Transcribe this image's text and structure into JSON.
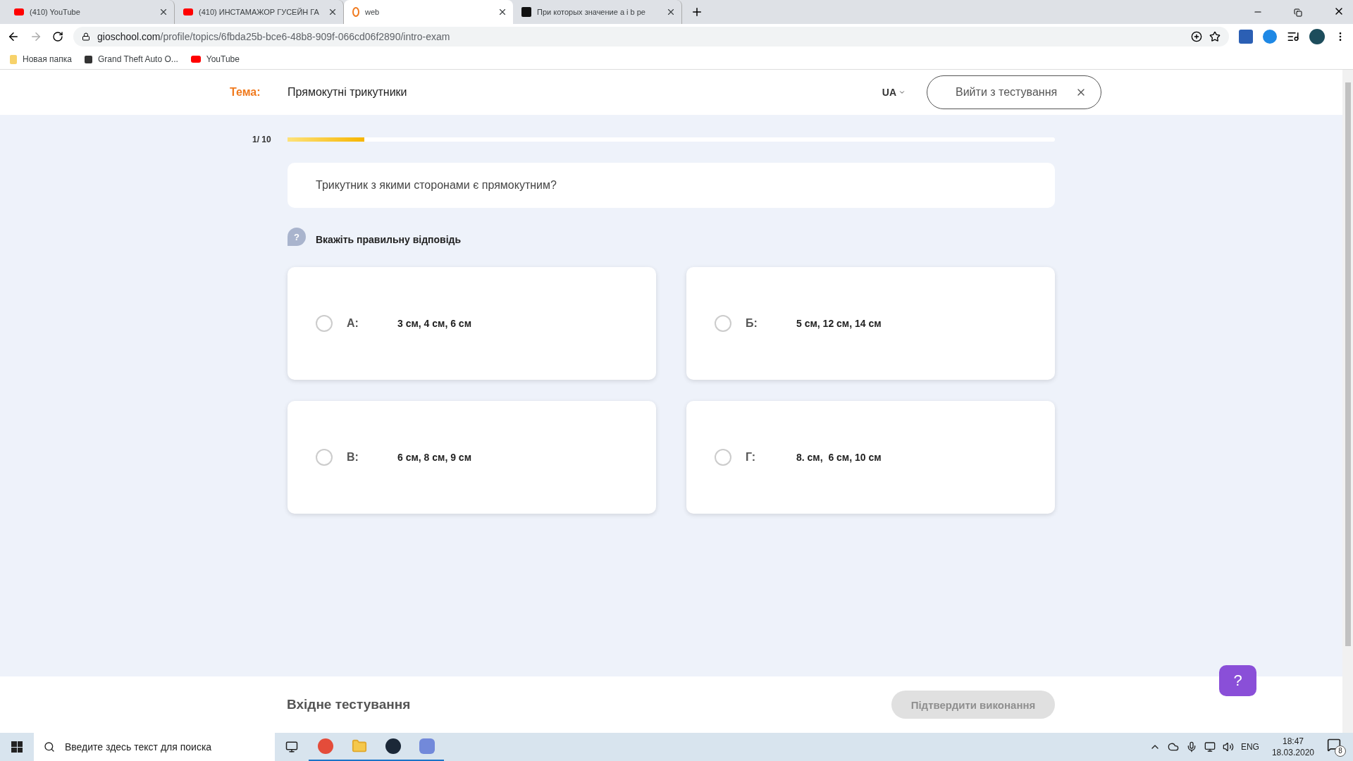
{
  "browser": {
    "tabs": [
      {
        "title": "(410) YouTube",
        "kind": "youtube",
        "selected": false
      },
      {
        "title": "(410) ИНСТАМАЖОР ГУСЕЙН ГА",
        "kind": "youtube",
        "selected": false
      },
      {
        "title": "web",
        "kind": "site",
        "selected": true
      },
      {
        "title": "При которых значение a i b ре",
        "kind": "qa",
        "selected": false
      }
    ],
    "url_host": "gioschool.com",
    "url_path": "/profile/topics/6fbda25b-bce6-48b8-909f-066cd06f2890/intro-exam",
    "bookmarks": [
      {
        "label": "Новая папка",
        "kind": "folder"
      },
      {
        "label": "Grand Theft Auto O...",
        "kind": "game"
      },
      {
        "label": "YouTube",
        "kind": "youtube"
      }
    ]
  },
  "header": {
    "topic_label": "Тема:",
    "topic": "Прямокутні трикутники",
    "language": "UA",
    "exit_button": "Вийти з тестування"
  },
  "progress": {
    "counter": "1/ 10",
    "level": 0.1
  },
  "question": "Трикутник з якими сторонами є прямокутним?",
  "hint": {
    "icon": "?",
    "text": "Вкажіть правильну відповідь"
  },
  "answers": [
    {
      "letter": "А:",
      "text": "3 см, 4 см, 6 см",
      "selected": false
    },
    {
      "letter": "Б:",
      "text": "5 см, 12 см, 14 см",
      "selected": false
    },
    {
      "letter": "В:",
      "text": "6 см, 8 см, 9 см",
      "selected": false
    },
    {
      "letter": "Г:",
      "text": "8. см,  6 см, 10 см",
      "selected": false
    }
  ],
  "footer": {
    "title": "Вхідне тестування",
    "confirm_button": {
      "label": "Підтвердити виконання",
      "disabled": true
    }
  },
  "help_button": "?",
  "taskbar": {
    "search_placeholder": "Введите здесь текст для поиска",
    "language": "ENG",
    "time": "18:47",
    "date": "18.03.2020",
    "notifications": "8"
  }
}
